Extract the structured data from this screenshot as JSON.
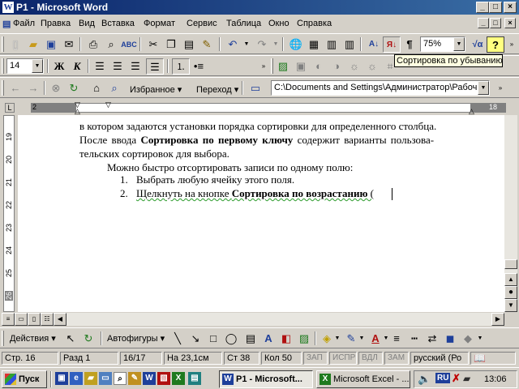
{
  "window": {
    "title": "P1 - Microsoft Word",
    "app_icon": "W",
    "minimize": "_",
    "maximize": "□",
    "close": "×"
  },
  "menu": {
    "items": [
      "Файл",
      "Правка",
      "Вид",
      "Вставка",
      "Формат",
      "Сервис",
      "Таблица",
      "Окно",
      "Справка"
    ]
  },
  "standard_toolbar": {
    "zoom": "75%"
  },
  "format_toolbar": {
    "font_size": "14",
    "bold": "Ж",
    "italic": "К"
  },
  "web_toolbar": {
    "favorites": "Избранное",
    "goto": "Переход",
    "address": "C:\\Documents and Settings\\Администратор\\Рабоч"
  },
  "tooltip": "Сортировка по убыванию",
  "ruler": {
    "left_num": "2",
    "right_num": "18"
  },
  "vertical_ruler": [
    "19",
    "20",
    "21",
    "22",
    "23",
    "24",
    "25",
    "26"
  ],
  "document": {
    "line1": "в котором задаются установки порядка сортировки для определенного столбца.",
    "line2_a": "После ввода ",
    "line2_b": "Сортировка по первому ключу",
    "line2_c": " содержит варианты пользова-",
    "line3": "тельских сортировок для выбора.",
    "line4": "Можно быстро отсортировать записи по одному полю:",
    "item1_num": "1.",
    "item1": "Выбрать любую ячейку этого поля.",
    "item2_num": "2.",
    "item2_a": "Щелкнуть на кнопке ",
    "item2_b": "Сортировка по возрастанию",
    "item2_c": " ("
  },
  "drawing_toolbar": {
    "actions": "Действия",
    "autoshapes": "Автофигуры"
  },
  "status": {
    "page": "Стр. 16",
    "section": "Разд 1",
    "pages": "16/17",
    "at": "На 23,1см",
    "line": "Ст 38",
    "col": "Кол 50",
    "rec": "ЗАП",
    "trk": "ИСПР",
    "ext": "ВДЛ",
    "ovr": "ЗАМ",
    "lang": "русский (Ро"
  },
  "taskbar": {
    "start": "Пуск",
    "word_task": "P1 - Microsoft...",
    "excel_task": "Microsoft Excel - ...",
    "lang": "RU",
    "time": "13:06"
  }
}
